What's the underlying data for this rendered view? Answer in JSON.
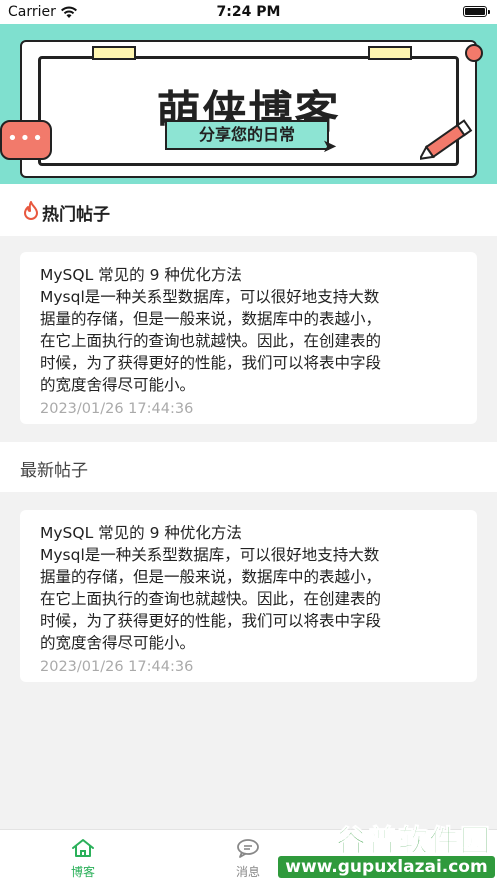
{
  "status_bar": {
    "carrier": "Carrier",
    "time": "7:24 PM"
  },
  "banner": {
    "title": "萌侠博客",
    "subtitle": "分享您的日常",
    "bubble_dots": "•••",
    "colors": {
      "background": "#7fe0cf",
      "accent": "#f27a6b",
      "clip": "#fff6b0"
    }
  },
  "hot_section": {
    "label": "热门帖子",
    "icon": "flame-icon",
    "icon_color": "#e8583f"
  },
  "hot_posts": [
    {
      "title": "MySQL 常见的 9 种优化方法",
      "lines": [
        "Mysql是一种关系型数据库，可以很好地支持大数",
        "据量的存储，但是一般来说，数据库中的表越小，",
        "在它上面执行的查询也就越快。因此，在创建表的",
        "时候，为了获得更好的性能，我们可以将表中字段",
        "的宽度舍得尽可能小。"
      ],
      "date": "2023/01/26 17:44:36"
    }
  ],
  "latest_section": {
    "label": "最新帖子"
  },
  "latest_posts": [
    {
      "title": "MySQL 常见的 9 种优化方法",
      "lines": [
        "Mysql是一种关系型数据库，可以很好地支持大数",
        "据量的存储，但是一般来说，数据库中的表越小，",
        "在它上面执行的查询也就越快。因此，在创建表的",
        "时候，为了获得更好的性能，我们可以将表中字段",
        "的宽度舍得尽可能小。"
      ],
      "date": "2023/01/26 17:44:36"
    }
  ],
  "tabbar": {
    "tabs": [
      {
        "label": "博客",
        "icon": "home-icon",
        "active": true,
        "color": "#2bb05a"
      },
      {
        "label": "消息",
        "icon": "chat-icon",
        "active": false,
        "color": "#888888"
      }
    ]
  },
  "watermark": {
    "top": "谷普软件园",
    "bottom": "www.gupuxlazai.com"
  }
}
